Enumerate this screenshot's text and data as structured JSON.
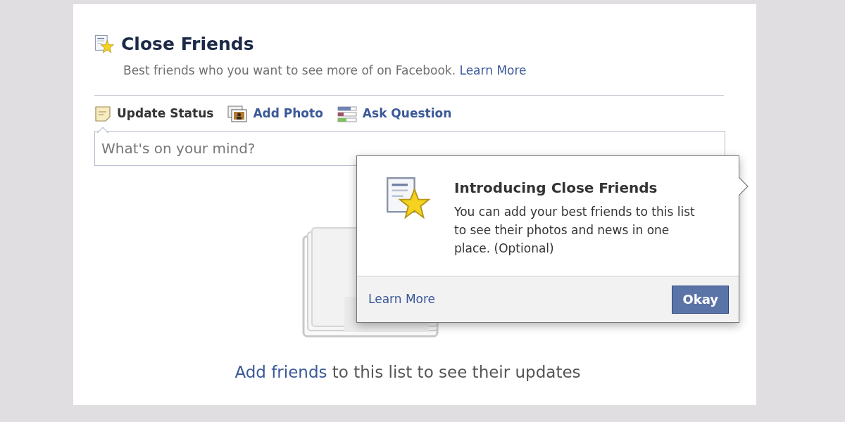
{
  "header": {
    "title": "Close Friends",
    "description": "Best friends who you want to see more of on Facebook.",
    "link": "Learn More"
  },
  "composer": {
    "tabs": [
      {
        "label": "Update Status",
        "kind": "status",
        "selected": true
      },
      {
        "label": "Add Photo",
        "kind": "photo",
        "selected": false
      },
      {
        "label": "Ask Question",
        "kind": "question",
        "selected": false
      }
    ],
    "placeholder": "What's on your mind?"
  },
  "popup": {
    "title": "Introducing Close Friends",
    "body": "You can add your best friends to this list to see their photos and news in one place. (Optional)",
    "link": "Learn More",
    "button": "Okay"
  },
  "empty_state": {
    "link": "Add friends",
    "text": "to this list to see their updates"
  }
}
